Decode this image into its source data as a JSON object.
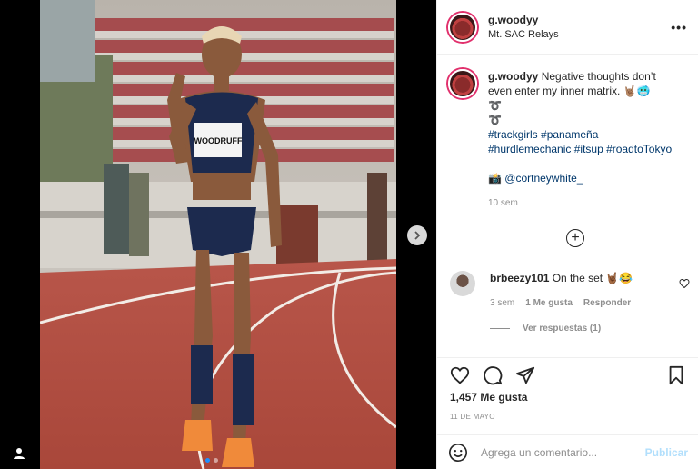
{
  "post": {
    "username": "g.woodyy",
    "location": "Mt. SAC Relays",
    "more_label": "•••",
    "photo_bib_name": "WOODRUFF"
  },
  "caption": {
    "username": "g.woodyy",
    "text_line1": "Negative thoughts don’t",
    "text_line2": "even enter my inner matrix. 🤘🏽🥶",
    "symbol1": "➰",
    "symbol2": "➰",
    "hashtags_line1": "#trackgirls #panameña",
    "hashtags_line2": "#hurdlemechanic #itsup #roadtoTokyo",
    "credit": "📸 @cortneywhite_",
    "time": "10 sem"
  },
  "load_more_label": "+",
  "comment": {
    "username": "brbeezy101",
    "text": "On the set 🤘🏾😂",
    "time": "3 sem",
    "likes": "1 Me gusta",
    "reply": "Responder",
    "view_replies": "Ver respuestas (1)"
  },
  "likes_count": "1,457 Me gusta",
  "date": "11 DE MAYO",
  "add_comment": {
    "placeholder": "Agrega un comentario...",
    "publish": "Publicar"
  },
  "colors": {
    "link": "#00376b",
    "muted": "#8e8e8e",
    "publish_disabled": "#b2dffc",
    "story_ring": "#e1306c",
    "dot_active": "#1e90ff"
  },
  "carousel": {
    "slides": 2,
    "active": 1
  }
}
